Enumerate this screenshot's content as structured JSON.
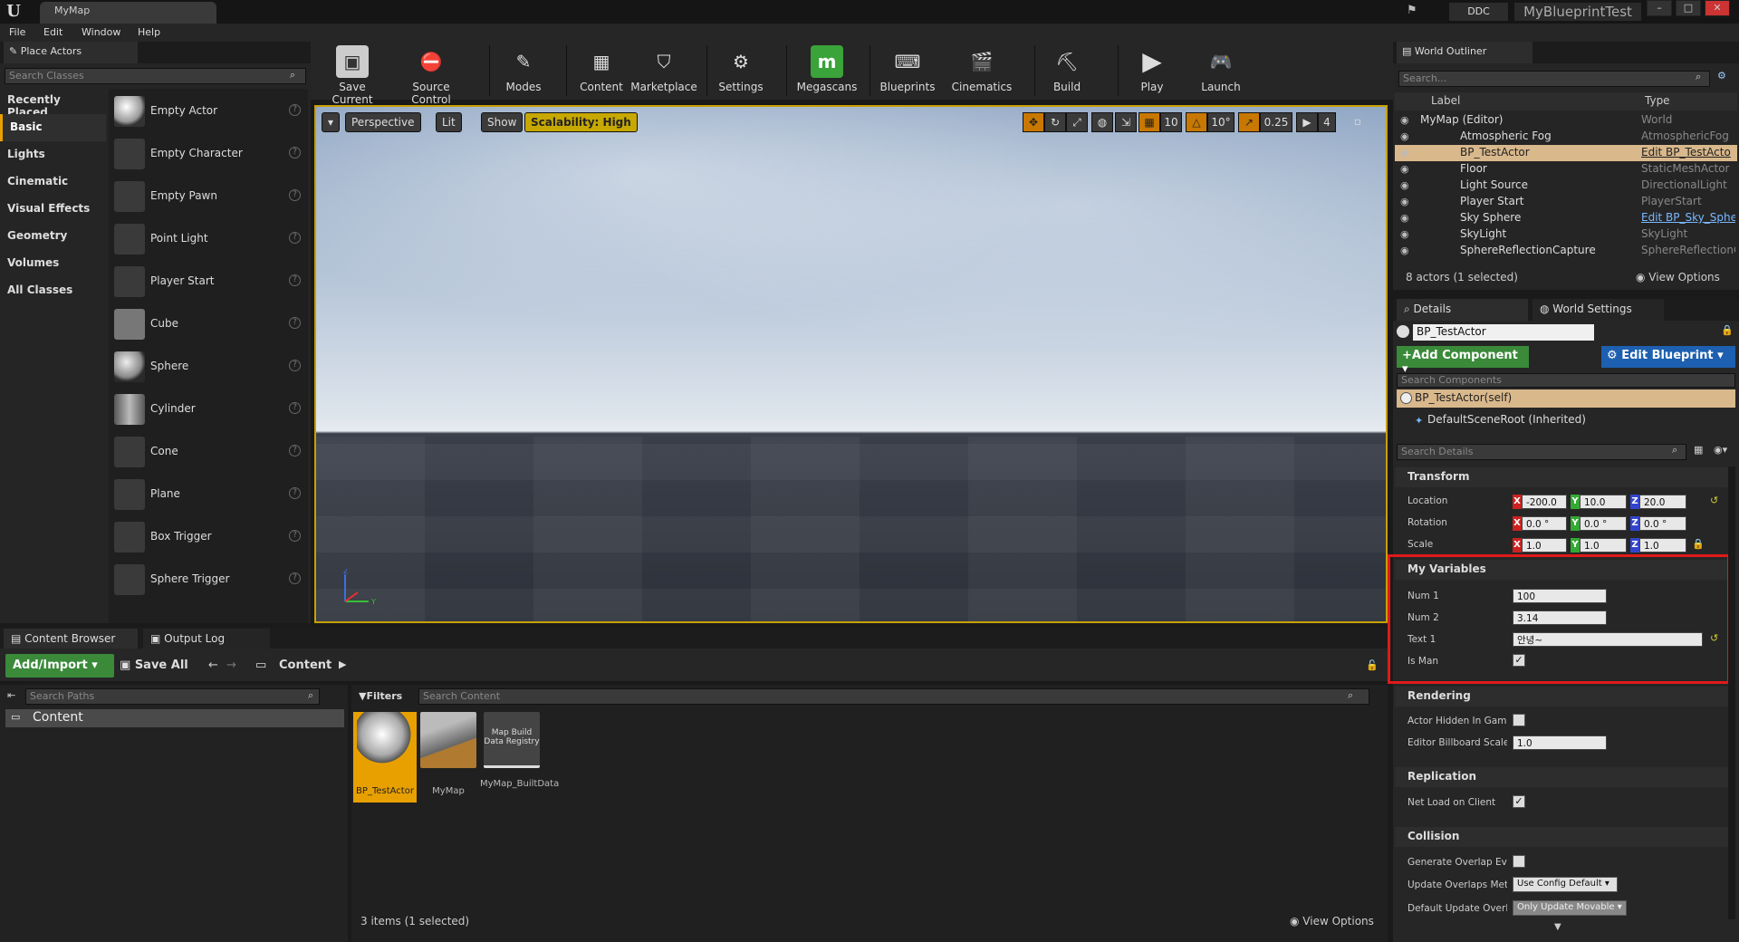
{
  "window": {
    "tab_title": "MyMap",
    "ddc": "DDC",
    "project": "MyBlueprintTest"
  },
  "menu": [
    "File",
    "Edit",
    "Window",
    "Help"
  ],
  "place_actors": {
    "tab": "Place Actors",
    "search_placeholder": "Search Classes",
    "categories": [
      "Recently Placed",
      "Basic",
      "Lights",
      "Cinematic",
      "Visual Effects",
      "Geometry",
      "Volumes",
      "All Classes"
    ],
    "active_category": "Basic",
    "items": [
      "Empty Actor",
      "Empty Character",
      "Empty Pawn",
      "Point Light",
      "Player Start",
      "Cube",
      "Sphere",
      "Cylinder",
      "Cone",
      "Plane",
      "Box Trigger",
      "Sphere Trigger"
    ]
  },
  "toolbar": [
    "Save Current",
    "Source Control",
    "Modes",
    "Content",
    "Marketplace",
    "Settings",
    "Megascans",
    "Blueprints",
    "Cinematics",
    "Build",
    "Play",
    "Launch"
  ],
  "viewport": {
    "perspective": "Perspective",
    "lit": "Lit",
    "show": "Show",
    "scalability": "Scalability: High",
    "grid_snap": "10",
    "rot_snap": "10°",
    "scale_snap": "0.25",
    "cam_speed": "4"
  },
  "content_browser": {
    "tab": "Content Browser",
    "output_tab": "Output Log",
    "add_import": "Add/Import",
    "save_all": "Save All",
    "path": "Content",
    "search_paths_placeholder": "Search Paths",
    "tree_root": "Content",
    "filters": "Filters",
    "search_content_placeholder": "Search Content",
    "assets": [
      {
        "name": "BP_TestActor",
        "selected": true
      },
      {
        "name": "MyMap",
        "selected": false
      },
      {
        "name": "MyMap_BuiltData",
        "thumb_text": "Map Build Data Registry",
        "selected": false
      }
    ],
    "count": "3 items (1 selected)",
    "view_options": "View Options"
  },
  "outliner": {
    "tab": "World Outliner",
    "search_placeholder": "Search...",
    "col_label": "Label",
    "col_type": "Type",
    "rows": [
      {
        "label": "MyMap (Editor)",
        "type": "World"
      },
      {
        "label": "Atmospheric Fog",
        "type": "AtmosphericFog"
      },
      {
        "label": "BP_TestActor",
        "type": "Edit BP_TestActo"
      },
      {
        "label": "Floor",
        "type": "StaticMeshActor"
      },
      {
        "label": "Light Source",
        "type": "DirectionalLight"
      },
      {
        "label": "Player Start",
        "type": "PlayerStart"
      },
      {
        "label": "Sky Sphere",
        "type": "Edit BP_Sky_Sphe"
      },
      {
        "label": "SkyLight",
        "type": "SkyLight"
      },
      {
        "label": "SphereReflectionCapture",
        "type": "SphereReflectionC"
      }
    ],
    "footer": "8 actors (1 selected)",
    "view_options": "View Options"
  },
  "details": {
    "tab": "Details",
    "world_settings_tab": "World Settings",
    "actor_name": "BP_TestActor",
    "add_component": "Add Component",
    "edit_blueprint": "Edit Blueprint",
    "search_components_placeholder": "Search Components",
    "comp_self": "BP_TestActor(self)",
    "comp_root": "DefaultSceneRoot (Inherited)",
    "search_details_placeholder": "Search Details",
    "transform": {
      "title": "Transform",
      "location_label": "Location",
      "rotation_label": "Rotation",
      "scale_label": "Scale",
      "location": [
        "-200.0",
        "10.0",
        "20.0"
      ],
      "rotation": [
        "0.0 °",
        "0.0 °",
        "0.0 °"
      ],
      "scale": [
        "1.0",
        "1.0",
        "1.0"
      ]
    },
    "my_variables": {
      "title": "My Variables",
      "num1_label": "Num 1",
      "num1": "100",
      "num2_label": "Num 2",
      "num2": "3.14",
      "text1_label": "Text 1",
      "text1": "안녕~",
      "isman_label": "Is Man",
      "isman": true
    },
    "rendering": {
      "title": "Rendering",
      "hidden_label": "Actor Hidden In Game",
      "billboard_label": "Editor Billboard Scale",
      "billboard": "1.0"
    },
    "replication": {
      "title": "Replication",
      "netload_label": "Net Load on Client"
    },
    "collision": {
      "title": "Collision",
      "gen_overlap_label": "Generate Overlap Ever",
      "update_overlaps_label": "Update Overlaps Meth",
      "update_overlaps": "Use Config Default",
      "default_update_label": "Default Update Overla",
      "default_update": "Only Update Movable"
    }
  },
  "colors": {
    "accent": "#e8a000",
    "highlight_box": "#e01a1a",
    "green_btn": "#3a8a3a",
    "blue_btn": "#1d5fb0"
  }
}
